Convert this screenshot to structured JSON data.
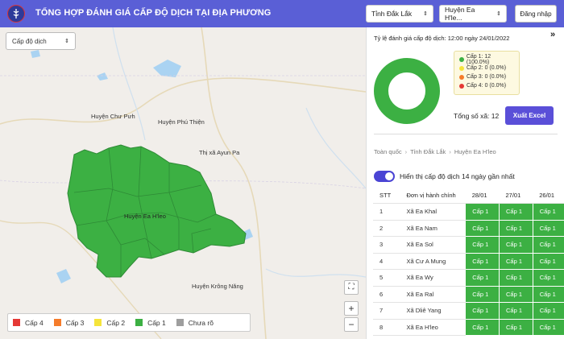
{
  "header": {
    "title": "TỔNG HỢP ĐÁNH GIÁ CẤP ĐỘ DỊCH TẠI ĐỊA PHƯƠNG",
    "province_select": "Tỉnh Đắk Lắk",
    "district_select": "Huyện Ea H'le...",
    "login_label": "Đăng nhập"
  },
  "map": {
    "layer_select": "Cấp độ dịch",
    "labels": {
      "chu_puh": "Huyện Chư Pưh",
      "phu_thien": "Huyện Phú Thiện",
      "ayun_pa": "Thị xã Ayun Pa",
      "ea_hleo": "Huyện Ea H'leo",
      "krong_nang": "Huyện Krông Năng"
    },
    "controls": {
      "fullscreen": "⛶",
      "zoom_in": "+",
      "zoom_out": "−"
    },
    "legend": [
      {
        "label": "Cấp 4",
        "color": "#e53935"
      },
      {
        "label": "Cấp 3",
        "color": "#f57c2b"
      },
      {
        "label": "Cấp 2",
        "color": "#f5e43b"
      },
      {
        "label": "Cấp 1",
        "color": "#3cb043"
      },
      {
        "label": "Chưa rõ",
        "color": "#9e9e9e"
      }
    ]
  },
  "panel": {
    "rate_title": "Tỷ lệ đánh giá cấp độ dịch: 12:00 ngày 24/01/2022",
    "donut_legend": [
      {
        "label": "Cấp 1: 12 (100.0%)",
        "color": "#3cb043"
      },
      {
        "label": "Cấp 2: 0 (0.0%)",
        "color": "#f5e43b"
      },
      {
        "label": "Cấp 3: 0 (0.0%)",
        "color": "#f57c2b"
      },
      {
        "label": "Cấp 4: 0 (0.0%)",
        "color": "#e53935"
      }
    ],
    "total_label": "Tổng số xã: 12",
    "excel_label": "Xuất Excel",
    "breadcrumb": [
      "Toàn quốc",
      "Tỉnh Đắk Lắk",
      "Huyện Ea H'leo"
    ],
    "toggle_label": "Hiển thị cấp độ dịch 14 ngày gần nhất",
    "table": {
      "headers": [
        "STT",
        "Đơn vị hành chính",
        "28/01",
        "27/01",
        "26/01"
      ],
      "rows": [
        {
          "stt": "1",
          "name": "Xã Ea Khal",
          "levels": [
            "Cấp 1",
            "Cấp 1",
            "Cấp 1"
          ]
        },
        {
          "stt": "2",
          "name": "Xã Ea Nam",
          "levels": [
            "Cấp 1",
            "Cấp 1",
            "Cấp 1"
          ]
        },
        {
          "stt": "3",
          "name": "Xã Ea Sol",
          "levels": [
            "Cấp 1",
            "Cấp 1",
            "Cấp 1"
          ]
        },
        {
          "stt": "4",
          "name": "Xã Cư A Mung",
          "levels": [
            "Cấp 1",
            "Cấp 1",
            "Cấp 1"
          ]
        },
        {
          "stt": "5",
          "name": "Xã Ea Wy",
          "levels": [
            "Cấp 1",
            "Cấp 1",
            "Cấp 1"
          ]
        },
        {
          "stt": "6",
          "name": "Xã Ea Ral",
          "levels": [
            "Cấp 1",
            "Cấp 1",
            "Cấp 1"
          ]
        },
        {
          "stt": "7",
          "name": "Xã Dliê Yang",
          "levels": [
            "Cấp 1",
            "Cấp 1",
            "Cấp 1"
          ]
        },
        {
          "stt": "8",
          "name": "Xã Ea H'leo",
          "levels": [
            "Cấp 1",
            "Cấp 1",
            "Cấp 1"
          ]
        }
      ]
    }
  }
}
